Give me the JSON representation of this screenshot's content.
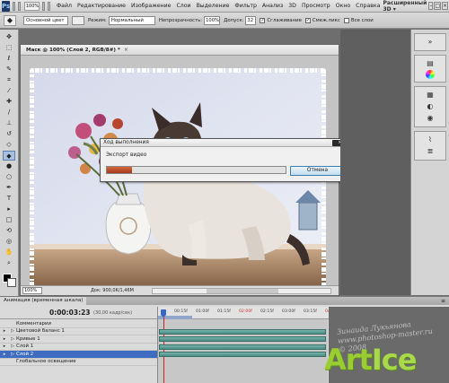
{
  "menubar": {
    "logo": "Ps",
    "zoom": "100%",
    "items": [
      "Файл",
      "Редактирование",
      "Изображение",
      "Слои",
      "Выделение",
      "Фильтр",
      "Анализ",
      "3D",
      "Просмотр",
      "Окно",
      "Справка"
    ],
    "workspace": "Расширенный 3D",
    "workspace_arrow": "▾",
    "window_controls": [
      "–",
      "□",
      "×"
    ]
  },
  "options": {
    "brush_preset": "Основной цвет",
    "mode_label": "Режим:",
    "mode_value": "Нормальный",
    "opacity_label": "Непрозрачность:",
    "opacity_value": "100%",
    "tolerance_label": "Допуск:",
    "tolerance_value": "32",
    "anti_alias_label": "Сглаживание",
    "contiguous_label": "Смеж.пикс",
    "all_layers_label": "Все слои",
    "check_mark": "✓"
  },
  "toolbox": {
    "tools": [
      {
        "name": "move-tool",
        "glyph": "✥"
      },
      {
        "name": "marquee-tool",
        "glyph": "⬚"
      },
      {
        "name": "lasso-tool",
        "glyph": "ℓ"
      },
      {
        "name": "quick-select-tool",
        "glyph": "✎"
      },
      {
        "name": "crop-tool",
        "glyph": "⌗"
      },
      {
        "name": "eyedropper-tool",
        "glyph": "⁄"
      },
      {
        "name": "heal-tool",
        "glyph": "✚"
      },
      {
        "name": "brush-tool",
        "glyph": "∕"
      },
      {
        "name": "stamp-tool",
        "glyph": "⊥"
      },
      {
        "name": "history-brush-tool",
        "glyph": "↺"
      },
      {
        "name": "eraser-tool",
        "glyph": "◇"
      },
      {
        "name": "paint-bucket-tool",
        "glyph": "◆"
      },
      {
        "name": "blur-tool",
        "glyph": "●"
      },
      {
        "name": "dodge-tool",
        "glyph": "○"
      },
      {
        "name": "pen-tool",
        "glyph": "✒"
      },
      {
        "name": "type-tool",
        "glyph": "T"
      },
      {
        "name": "path-select-tool",
        "glyph": "▸"
      },
      {
        "name": "shape-tool",
        "glyph": "□"
      },
      {
        "name": "3d-rotate-tool",
        "glyph": "⟲"
      },
      {
        "name": "3d-camera-tool",
        "glyph": "◎"
      },
      {
        "name": "hand-tool",
        "glyph": "✋"
      },
      {
        "name": "zoom-tool",
        "glyph": "⌕"
      }
    ],
    "active_tool": "paint-bucket-tool"
  },
  "document": {
    "title": "Маск @ 100% (Слой 2, RGB/8#) *",
    "close": "×",
    "zoom": "100%",
    "info": "Док: 900,0K/1,46M"
  },
  "dialog": {
    "title": "Ход выполнения",
    "close": "×",
    "label": "Экспорт видео",
    "cancel": "Отмена",
    "progress": 0.14
  },
  "right_panel": {
    "icons": [
      "collapse-icon",
      "layers-icon",
      "color-wheel-icon",
      "swatches-icon",
      "adjustments-icon",
      "masks-icon",
      "paths-icon",
      "channels-icon"
    ]
  },
  "animation": {
    "tab_label": "Анимация (временная шкала)",
    "menu": "≡",
    "timecode": "0:00:03:23",
    "fps": "(30,00 кадр/сек)",
    "ruler_ticks": [
      {
        "label": "00:15f",
        "red": false
      },
      {
        "label": "01:00f",
        "red": false
      },
      {
        "label": "01:15f",
        "red": false
      },
      {
        "label": "02:00f",
        "red": true
      },
      {
        "label": "02:15f",
        "red": false
      },
      {
        "label": "03:00f",
        "red": false
      },
      {
        "label": "03:15f",
        "red": false
      },
      {
        "label": "04:00f",
        "red": true
      }
    ],
    "layers": [
      {
        "name": "Комментарии",
        "selected": false,
        "has_bar": false
      },
      {
        "name": "Цветовой баланс 1",
        "selected": false,
        "has_bar": true
      },
      {
        "name": "Кривые 1",
        "selected": false,
        "has_bar": true
      },
      {
        "name": "Слой 1",
        "selected": false,
        "has_bar": true
      },
      {
        "name": "Слой 2",
        "selected": true,
        "has_bar": true
      },
      {
        "name": "Глобальное освещение",
        "selected": false,
        "has_bar": false
      }
    ]
  },
  "watermark": {
    "signature": "Зинаида Лукьянова",
    "site_line": "www.photoshop-master.ru",
    "year": "© 2008",
    "logo_art": "Art",
    "logo_ice": "Ice"
  }
}
